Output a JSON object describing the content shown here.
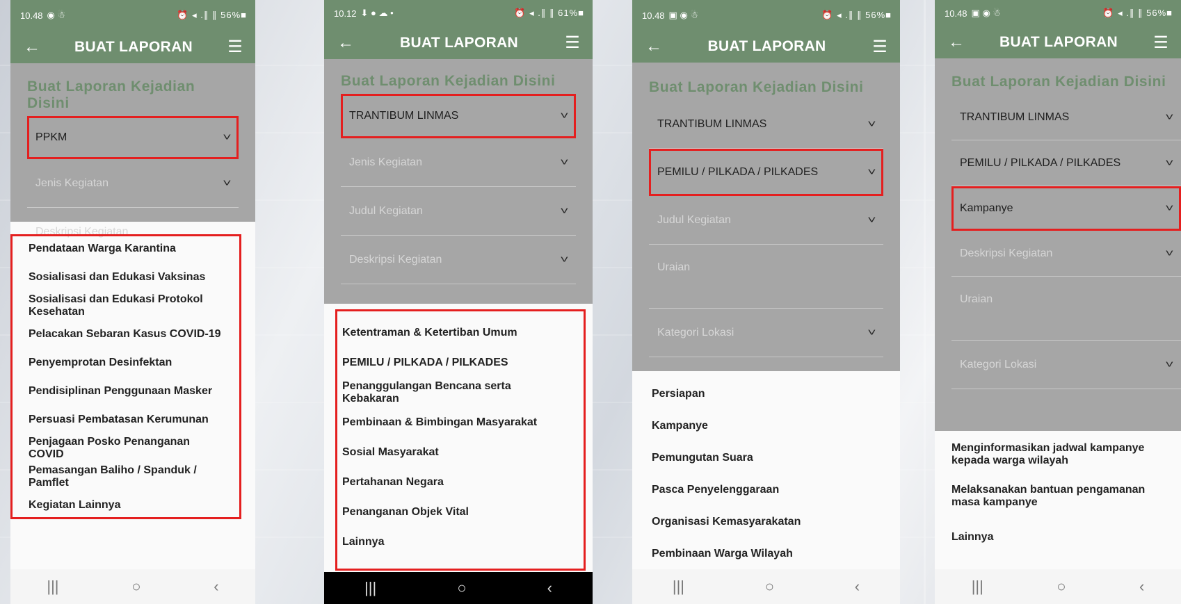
{
  "phones": [
    {
      "status": {
        "time": "10.48",
        "icons_left": "◉ ☃",
        "icons_right": "⏰ ◂ .∥ ∥ 56%■"
      },
      "appbar": {
        "title": "BUAT LAPORAN"
      },
      "form": {
        "heading": "Buat Laporan Kejadian Disini",
        "fields": [
          {
            "label": "PPKM",
            "placeholder": false,
            "chevron": true
          },
          {
            "label": "Jenis Kegiatan",
            "placeholder": true,
            "chevron": true
          },
          {
            "label": "Deskripsi Kegiatan",
            "placeholder": true,
            "chevron": false
          }
        ]
      },
      "options": [
        "Pendataan Warga Karantina",
        "Sosialisasi dan Edukasi Vaksinas",
        "Sosialisasi dan Edukasi Protokol Kesehatan",
        "Pelacakan Sebaran Kasus COVID-19",
        "Penyemprotan Desinfektan",
        "Pendisiplinan Penggunaan Masker",
        "Persuasi Pembatasan Kerumunan",
        "Penjagaan Posko Penanganan COVID",
        "Pemasangan Baliho / Spanduk / Pamflet",
        "Kegiatan Lainnya"
      ]
    },
    {
      "status": {
        "time": "10.12",
        "icons_left": "⬇ ● ☁ •",
        "icons_right": "⏰ ◂ .∥ ∥ 61%■"
      },
      "appbar": {
        "title": "BUAT LAPORAN"
      },
      "form": {
        "heading": "Buat Laporan Kejadian Disini",
        "fields": [
          {
            "label": "TRANTIBUM LINMAS",
            "placeholder": false,
            "chevron": true
          },
          {
            "label": "Jenis Kegiatan",
            "placeholder": true,
            "chevron": true
          },
          {
            "label": "Judul Kegiatan",
            "placeholder": true,
            "chevron": true
          },
          {
            "label": "Deskripsi Kegiatan",
            "placeholder": true,
            "chevron": true
          }
        ]
      },
      "options": [
        "Ketentraman & Ketertiban Umum",
        "PEMILU / PILKADA / PILKADES",
        "Penanggulangan Bencana serta Kebakaran",
        "Pembinaan & Bimbingan Masyarakat",
        "Sosial Masyarakat",
        "Pertahanan Negara",
        "Penanganan Objek Vital",
        "Lainnya"
      ]
    },
    {
      "status": {
        "time": "10.48",
        "icons_left": "▣ ◉ ☃",
        "icons_right": "⏰ ◂ .∥ ∥ 56%■"
      },
      "appbar": {
        "title": "BUAT LAPORAN"
      },
      "form": {
        "heading": "Buat Laporan Kejadian Disini",
        "fields": [
          {
            "label": "TRANTIBUM LINMAS",
            "placeholder": false,
            "chevron": true
          },
          {
            "label": "PEMILU / PILKADA / PILKADES",
            "placeholder": false,
            "chevron": true
          },
          {
            "label": "Judul Kegiatan",
            "placeholder": true,
            "chevron": true
          },
          {
            "label": "Uraian",
            "placeholder": true,
            "chevron": false
          },
          {
            "label": "Kategori Lokasi",
            "placeholder": true,
            "chevron": true
          }
        ]
      },
      "options": [
        "Persiapan",
        "Kampanye",
        "Pemungutan Suara",
        "Pasca Penyelenggaraan",
        "Organisasi Kemasyarakatan",
        "Pembinaan Warga Wilayah"
      ]
    },
    {
      "status": {
        "time": "10.48",
        "icons_left": "▣ ◉ ☃",
        "icons_right": "⏰ ◂ .∥ ∥ 56%■"
      },
      "appbar": {
        "title": "BUAT LAPORAN"
      },
      "form": {
        "heading": "Buat Laporan Kejadian Disini",
        "fields": [
          {
            "label": "TRANTIBUM LINMAS",
            "placeholder": false,
            "chevron": true
          },
          {
            "label": "PEMILU / PILKADA / PILKADES",
            "placeholder": false,
            "chevron": true
          },
          {
            "label": "Kampanye",
            "placeholder": false,
            "chevron": true
          },
          {
            "label": "Deskripsi Kegiatan",
            "placeholder": true,
            "chevron": true
          },
          {
            "label": "Uraian",
            "placeholder": true,
            "chevron": false
          },
          {
            "label": "Kategori Lokasi",
            "placeholder": true,
            "chevron": true
          }
        ]
      },
      "options": [
        "Menginformasikan jadwal kampanye  kepada warga  wilayah",
        "Melaksanakan bantuan pengamanan masa kampanye",
        "Lainnya"
      ]
    }
  ],
  "icons": {
    "back": "←",
    "menu": "☰",
    "chevron": "˅",
    "nav_recents": "|||",
    "nav_home": "○",
    "nav_back": "‹"
  },
  "colors": {
    "appbar": "#6f8e6f",
    "form_bg": "#a6a6a6",
    "highlight": "#e41f1f"
  }
}
